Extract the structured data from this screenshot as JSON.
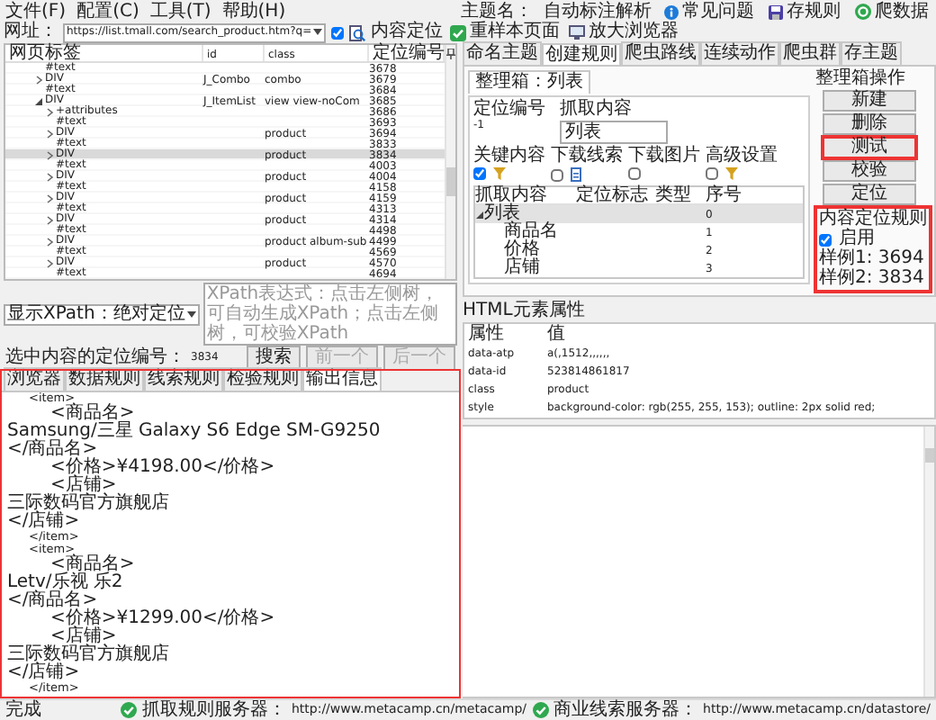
{
  "menu": [
    "文件(F)",
    "配置(C)",
    "工具(T)",
    "帮助(H)"
  ],
  "topic": {
    "label": "主题名：",
    "value": "自动标注解析"
  },
  "top_buttons": [
    {
      "label": "常见问题",
      "kind": "info"
    },
    {
      "label": "存规则",
      "kind": "save"
    },
    {
      "label": "爬数据",
      "kind": "crawl"
    }
  ],
  "address": {
    "label": "网址：",
    "value": "https://list.tmall.com/search_product.htm?q="
  },
  "content_locate": {
    "label": "内容定位",
    "checked": true
  },
  "tool_buttons": [
    {
      "label": "重样本页面",
      "kind": "reload"
    },
    {
      "label": "放大浏览器",
      "kind": "enlarge"
    }
  ],
  "tree": {
    "columns": [
      "网页标签",
      "id",
      "class",
      "定位编号"
    ],
    "rows": [
      {
        "tag": "#text",
        "number": "3678",
        "selected": false
      },
      {
        "tag": "DIV",
        "id": "J_Combo",
        "class": "combo",
        "number": "3679",
        "expanded": false,
        "selected": false
      },
      {
        "tag": "#text",
        "number": "3684",
        "selected": false
      },
      {
        "tag": "DIV",
        "id": "J_ItemList",
        "class": "view  view-noCom",
        "number": "3685",
        "expanded": true,
        "selected": false,
        "children": [
          {
            "tag": "+attributes",
            "number": "3686",
            "expanded": false,
            "selected": false
          },
          {
            "tag": "#text",
            "number": "3693",
            "selected": false
          },
          {
            "tag": "DIV",
            "class": "product",
            "number": "3694",
            "expanded": false,
            "selected": false
          },
          {
            "tag": "#text",
            "number": "3833",
            "selected": false
          },
          {
            "tag": "DIV",
            "class": "product",
            "number": "3834",
            "expanded": false,
            "selected": true
          },
          {
            "tag": "#text",
            "number": "4003",
            "selected": false
          },
          {
            "tag": "DIV",
            "class": "product",
            "number": "4004",
            "expanded": false,
            "selected": false
          },
          {
            "tag": "#text",
            "number": "4158",
            "selected": false
          },
          {
            "tag": "DIV",
            "class": "product",
            "number": "4159",
            "expanded": false,
            "selected": false
          },
          {
            "tag": "#text",
            "number": "4313",
            "selected": false
          },
          {
            "tag": "DIV",
            "class": "product",
            "number": "4314",
            "expanded": false,
            "selected": false
          },
          {
            "tag": "#text",
            "number": "4498",
            "selected": false
          },
          {
            "tag": "DIV",
            "class": "product album-sub",
            "number": "4499",
            "expanded": false,
            "selected": false
          },
          {
            "tag": "#text",
            "number": "4569",
            "selected": false
          },
          {
            "tag": "DIV",
            "class": "product",
            "number": "4570",
            "expanded": false,
            "selected": false
          },
          {
            "tag": "#text",
            "number": "4694",
            "selected": false
          }
        ]
      }
    ]
  },
  "xpath": {
    "mode": "显示XPath：绝对定位",
    "placeholder": "XPath表达式：点击左侧树，可自动生成XPath；点击左侧树，可校验XPath",
    "search": "搜索"
  },
  "selection": {
    "label": "选中内容的定位编号：",
    "value": "3834"
  },
  "nav_buttons": [
    {
      "label": "前一个",
      "disabled": true
    },
    {
      "label": "后一个",
      "disabled": true
    }
  ],
  "rule_tabs": [
    {
      "label": "命名主题",
      "selected": false
    },
    {
      "label": "创建规则",
      "selected": true
    },
    {
      "label": "爬虫路线",
      "selected": false
    },
    {
      "label": "连续动作",
      "selected": false
    },
    {
      "label": "爬虫群",
      "selected": false
    },
    {
      "label": "存主题",
      "selected": false
    }
  ],
  "box_tab": "整理箱：列表",
  "locate_number": {
    "label": "定位编号",
    "value": "-1"
  },
  "capture": {
    "label": "抓取内容",
    "value": "列表"
  },
  "options": [
    {
      "label": "关键内容",
      "checked": true,
      "kind": "filter"
    },
    {
      "label": "下载线索",
      "checked": false,
      "kind": "document"
    },
    {
      "label": "下载图片",
      "checked": false,
      "kind": "plain"
    },
    {
      "label": "高级设置",
      "checked": false,
      "kind": "filter"
    }
  ],
  "capture_table": {
    "columns": [
      "抓取内容",
      "定位标志",
      "类型",
      "序号"
    ],
    "rows": [
      {
        "content": "列表",
        "order": "0",
        "expanded": true,
        "selected": true,
        "children": [
          {
            "content": "商品名",
            "order": "1",
            "selected": false
          },
          {
            "content": "价格",
            "order": "2",
            "selected": false
          },
          {
            "content": "店铺",
            "order": "3",
            "selected": false
          }
        ]
      }
    ]
  },
  "box_actions": {
    "title": "整理箱操作",
    "buttons": [
      {
        "label": "新建",
        "highlighted": false
      },
      {
        "label": "删除",
        "highlighted": false
      },
      {
        "label": "测试",
        "highlighted": true
      },
      {
        "label": "校验",
        "highlighted": false
      },
      {
        "label": "定位",
        "highlighted": false
      }
    ]
  },
  "locate_rule": {
    "title": "内容定位规则",
    "highlighted": true,
    "enable": {
      "label": "启用",
      "checked": true
    },
    "samples": [
      "样例1: 3694",
      "样例2: 3834"
    ]
  },
  "html_attributes": {
    "title": "HTML元素属性",
    "columns": [
      "属性",
      "值"
    ],
    "rows": [
      [
        "data-atp",
        "a(,1512,,,,,,"
      ],
      [
        "data-id",
        "523814861817"
      ],
      [
        "class",
        "product"
      ],
      [
        "style",
        "background-color: rgb(255, 255, 153); outline: 2px solid red;"
      ]
    ]
  },
  "bottom_tabs": [
    {
      "label": "浏览器",
      "selected": false
    },
    {
      "label": "数据规则",
      "selected": false
    },
    {
      "label": "线索规则",
      "selected": false
    },
    {
      "label": "检验规则",
      "selected": false
    },
    {
      "label": "输出信息",
      "selected": true
    }
  ],
  "output_highlighted": true,
  "output_lines": [
    {
      "text": "<item>",
      "kind": "item"
    },
    {
      "text": "<商品名>",
      "kind": "field"
    },
    {
      "text": "Samsung/三星 Galaxy S6 Edge SM-G9250",
      "kind": "value"
    },
    {
      "text": "</商品名>",
      "kind": "value"
    },
    {
      "text": "<价格>¥4198.00</价格>",
      "kind": "field"
    },
    {
      "text": "<店铺>",
      "kind": "field"
    },
    {
      "text": "三际数码官方旗舰店",
      "kind": "value"
    },
    {
      "text": "</店铺>",
      "kind": "value"
    },
    {
      "text": "</item>",
      "kind": "item"
    },
    {
      "text": "<item>",
      "kind": "item"
    },
    {
      "text": "<商品名>",
      "kind": "field"
    },
    {
      "text": "Letv/乐视 乐2",
      "kind": "value"
    },
    {
      "text": "</商品名>",
      "kind": "value"
    },
    {
      "text": "<价格>¥1299.00</价格>",
      "kind": "field"
    },
    {
      "text": "<店铺>",
      "kind": "field"
    },
    {
      "text": "三际数码官方旗舰店",
      "kind": "value"
    },
    {
      "text": "</店铺>",
      "kind": "value"
    },
    {
      "text": "</item>",
      "kind": "item"
    }
  ],
  "status": {
    "text": "完成",
    "servers": [
      {
        "label": "抓取规则服务器：",
        "url": "http://www.metacamp.cn/metacamp/",
        "ok": true
      },
      {
        "label": "商业线索服务器：",
        "url": "http://www.metacamp.cn/datastore/",
        "ok": true
      }
    ]
  }
}
